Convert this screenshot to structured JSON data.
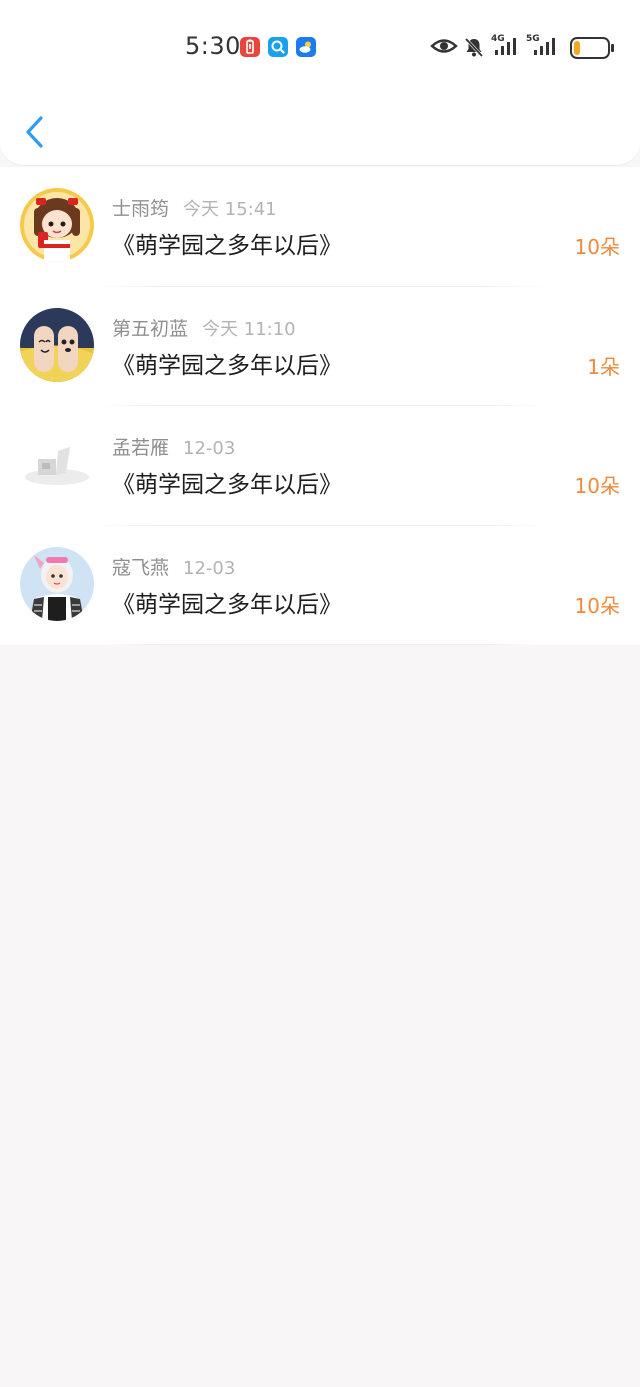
{
  "status_bar": {
    "time": "5:30",
    "network_1": "4G",
    "network_2": "5G",
    "battery_level": 0.15,
    "colors": {
      "battery_fill": "#f5a623",
      "notif_red": "#e8453c",
      "notif_search": "#1aa0f0",
      "notif_weather": "#1a7cf0"
    }
  },
  "header": {
    "back_icon": "chevron-left-icon"
  },
  "gifts": [
    {
      "sender": "士雨筠",
      "time": "今天 15:41",
      "title": "《萌学园之多年以后》",
      "amount": "10朵"
    },
    {
      "sender": "第五初蓝",
      "time": "今天 11:10",
      "title": "《萌学园之多年以后》",
      "amount": "1朵"
    },
    {
      "sender": "孟若雁",
      "time": "12-03",
      "title": "《萌学园之多年以后》",
      "amount": "10朵"
    },
    {
      "sender": "寇飞燕",
      "time": "12-03",
      "title": "《萌学园之多年以后》",
      "amount": "10朵"
    }
  ],
  "colors": {
    "accent": "#2f9cf0",
    "amount": "#f08a3a"
  }
}
